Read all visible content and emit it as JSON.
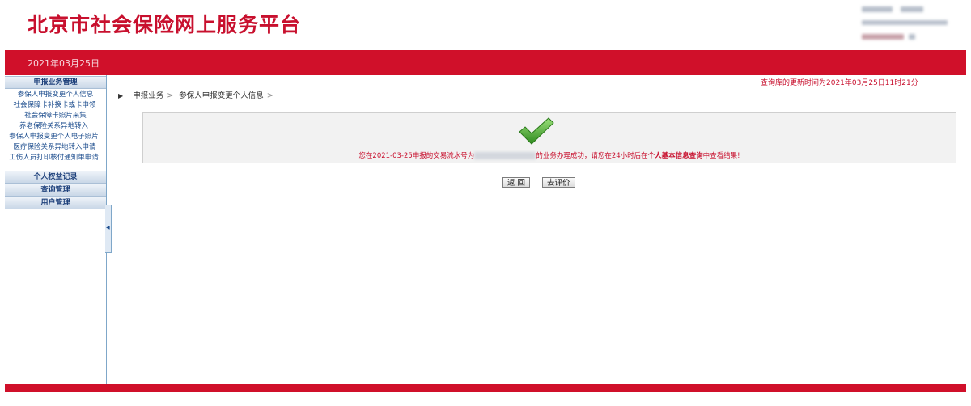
{
  "header": {
    "site_title": "北京市社会保险网上服务平台"
  },
  "topbar": {
    "date": "2021年03月25日"
  },
  "sidebar": {
    "sections": [
      {
        "label": "申报业务管理",
        "items": [
          {
            "label": "参保人申报变更个人信息"
          },
          {
            "label": "社会保障卡补换卡或卡申领"
          },
          {
            "label": "社会保障卡照片采集"
          },
          {
            "label": "养老保险关系异地转入"
          },
          {
            "label": "参保人申报变更个人电子照片"
          },
          {
            "label": "医疗保险关系异地转入申请"
          },
          {
            "label": "工伤人员打印核付通知单申请"
          }
        ]
      },
      {
        "label": "个人权益记录",
        "items": []
      },
      {
        "label": "查询管理",
        "items": []
      },
      {
        "label": "用户管理",
        "items": []
      }
    ],
    "collapse_icon": "chevron-left-icon"
  },
  "main": {
    "update_time": "查询库的更新时间为2021年03月25日11时21分",
    "breadcrumb": {
      "items": [
        {
          "label": "申报业务"
        },
        {
          "label": "参保人申报变更个人信息"
        }
      ]
    },
    "result": {
      "icon": "checkmark-icon",
      "msg_prefix": "您在2021-03-25申报的交易流水号为",
      "msg_middle": "的业务办理成功，请您在24小时后在",
      "msg_link": "个人基本信息查询",
      "msg_suffix": "中查看结果!"
    },
    "buttons": {
      "back_label": "返 回",
      "evaluate_label": "去评价"
    }
  },
  "colors": {
    "brand_red": "#d0102a",
    "title_red": "#c8102e",
    "link_blue": "#1f4f8f",
    "success_green": "#4aa02c"
  }
}
